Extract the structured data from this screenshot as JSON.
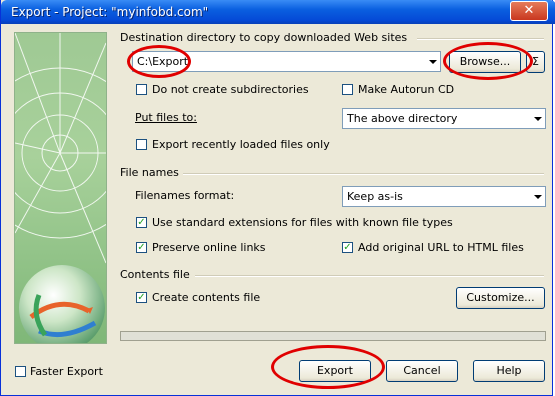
{
  "window": {
    "title": "Export - Project: \"myinfobd.com\"",
    "close_glyph": "✕"
  },
  "destination": {
    "label": "Destination directory to copy downloaded Web sites",
    "value": "C:\\Export",
    "browse_label": "Browse...",
    "sigma_label": "Σ",
    "no_subdirs_label": "Do not create subdirectories",
    "autorun_label": "Make Autorun CD",
    "put_files_label": "Put files to:",
    "put_files_value": "The above directory",
    "recent_only_label": "Export recently loaded files only",
    "checks": {
      "no_subdirs": false,
      "autorun": false,
      "recent_only": false
    }
  },
  "file_names": {
    "label": "File names",
    "format_label": "Filenames format:",
    "format_value": "Keep as-is",
    "std_ext_label": "Use standard extensions for files with known file types",
    "preserve_links_label": "Preserve online links",
    "add_url_label": "Add original URL to HTML files",
    "checks": {
      "std_ext": true,
      "preserve_links": true,
      "add_url": true
    }
  },
  "contents": {
    "label": "Contents file",
    "create_label": "Create contents file",
    "customize_label": "Customize...",
    "checks": {
      "create": true
    }
  },
  "footer": {
    "faster_export_label": "Faster Export",
    "export_label": "Export",
    "cancel_label": "Cancel",
    "help_label": "Help",
    "checks": {
      "faster_export": false
    }
  },
  "check_glyph": "✓",
  "colors": {
    "title_bar": "#0a5fe0",
    "annotation_oval": "#e00000",
    "dialog_bg": "#ece9d8"
  }
}
